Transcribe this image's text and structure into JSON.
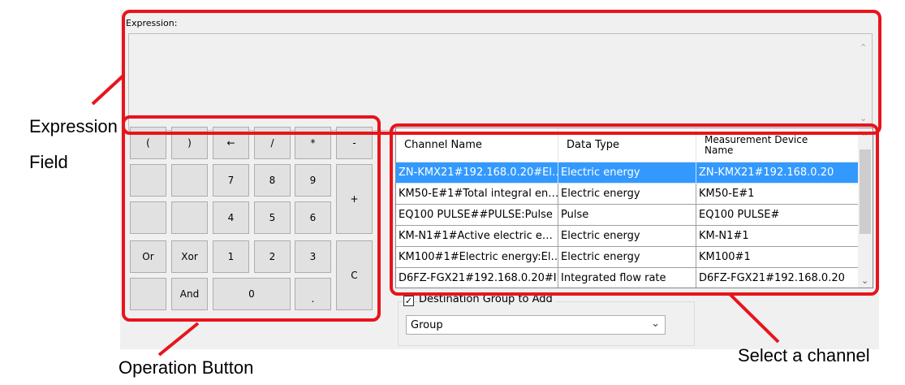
{
  "expression": {
    "label": "Expression:",
    "value": ""
  },
  "calculator": {
    "buttons": {
      "lparen": "(",
      "rparen": ")",
      "backspace": "←",
      "divide": "/",
      "multiply": "*",
      "minus": "-",
      "seven": "7",
      "eight": "8",
      "nine": "9",
      "plus": "+",
      "four": "4",
      "five": "5",
      "six": "6",
      "or": "Or",
      "xor": "Xor",
      "one": "1",
      "two": "2",
      "three": "3",
      "clear": "C",
      "and": "And",
      "zero": "0",
      "dot": "."
    }
  },
  "channel_table": {
    "headers": {
      "channel_name": "Channel Name",
      "data_type": "Data Type",
      "device_line1": "Measurement Device",
      "device_line2": "Name"
    },
    "rows": [
      {
        "channel": "ZN-KMX21#192.168.0.20#El…",
        "type": "Electric energy",
        "device": "ZN-KMX21#192.168.0.20",
        "selected": true
      },
      {
        "channel": "KM50-E#1#Total integral en…",
        "type": "Electric energy",
        "device": "KM50-E#1",
        "selected": false
      },
      {
        "channel": "EQ100 PULSE##PULSE:Pulse",
        "type": "Pulse",
        "device": "EQ100 PULSE#",
        "selected": false
      },
      {
        "channel": "KM-N1#1#Active electric e…",
        "type": "Electric energy",
        "device": "KM-N1#1",
        "selected": false
      },
      {
        "channel": "KM100#1#Electric energy:El…",
        "type": "Electric energy",
        "device": "KM100#1",
        "selected": false
      },
      {
        "channel": "D6FZ-FGX21#192.168.0.20#I…",
        "type": "Integrated flow rate",
        "device": "D6FZ-FGX21#192.168.0.20",
        "selected": false
      }
    ]
  },
  "destination": {
    "label": "Destination Group to Add",
    "checked": true,
    "check_glyph": "✓",
    "group_value": "Group"
  },
  "annotations": {
    "expression_field_1": "Expression",
    "expression_field_2": "Field",
    "operation_button": "Operation Button",
    "select_channel": "Select a channel",
    "highlight_color": "#e8141c"
  },
  "colors": {
    "selection": "#3399ff",
    "panel": "#f0f0f0"
  }
}
